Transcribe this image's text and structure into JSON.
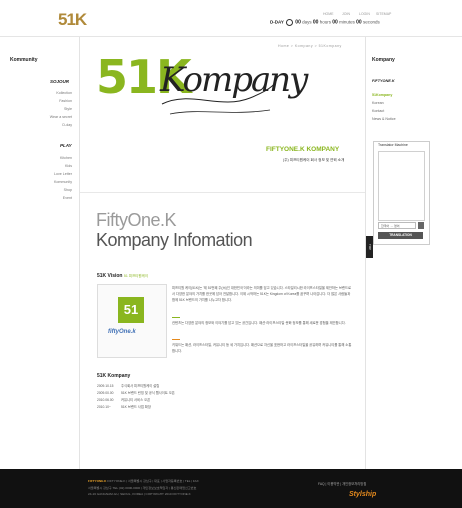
{
  "header": {
    "logo_main": "51",
    "logo_k": "K",
    "util_links": [
      "HOME",
      "JOIN",
      "LOGIN",
      "SITEMAP"
    ],
    "dday": {
      "label": "D-DAY",
      "days_value": "00",
      "days_label": "days",
      "hours_value": "00",
      "hours_label": "hours",
      "minutes_value": "00",
      "minutes_label": "minutes",
      "seconds_value": "00",
      "seconds_label": "seconds"
    }
  },
  "left_nav": {
    "section1_title": "Kommunity",
    "section1_sub": "SOJOUR",
    "section1_items": [
      "Kollection",
      "Fashion",
      "Style",
      "Wear a secret",
      "D-day"
    ],
    "section2_sub": "PLAY",
    "section2_items": [
      "Kitchen",
      "Kids",
      "Love Letter",
      "Kommunity",
      "Shop",
      "Event"
    ]
  },
  "right_nav": {
    "title": "Kompany",
    "sub": "FIFTYONE.K",
    "items": [
      "51Kompany",
      "Korean",
      "Kontact",
      "News & Notice"
    ],
    "active_index": 0
  },
  "translator": {
    "title": "Translator Machine",
    "select_value": "한국어 → 영어",
    "button": "TRANSLATION"
  },
  "top_button": "TOP",
  "main": {
    "breadcrumb": "Home  >  Kompany  >  51Kompany",
    "hero_number": "51K",
    "hero_script": "Kompany",
    "company_name": "FIFTYONE.K KOMPANY",
    "company_sub": "(주) 피프티원케이 회사 정보 및 연혁 소개",
    "info_title_line1": "FiftyOne.K",
    "info_title_line2": "Kompany Infomation",
    "vision_title": "51K Vision",
    "vision_sub": "51 피프티원케이",
    "vision_logo": "51",
    "vision_logo_text": "fiftyOne.k",
    "paragraphs": [
      "피프티원 케이(51K)는 '제 51번째 주(州)인 대한민국'이라는 의미를 담고 있습니다. 스타일리시한 라이프스타일을 제안하는 브랜드로서 다양한 분야의 가치를 한곳에 담아 전달합니다. 이제 시작하는 51K는 Kingdom of Korea를 꿈꾸며 나아갑니다. 더 많은 사람들과 함께 51K 브랜드의 가치를 나누고자 합니다.",
      "컨텐츠는 다양한 분야의 정보와 이야기를 담고 있는 공간입니다. 패션·라이프스타일·문화 정보를 통해 새로운 경험을 제안합니다.",
      "키워드는 패션, 라이프스타일, 커뮤니티 등 세 가지입니다. 패션으로 자신을 표현하고 라이프스타일을 공유하며 커뮤니티를 통해 소통합니다."
    ],
    "company_history_title": "51K Kompany",
    "history": [
      {
        "date": "2009.10.15",
        "text": "주식회사 피프티원케이 설립"
      },
      {
        "date": "2009.00.00",
        "text": "51K 브랜드 런칭 및 공식 웹사이트 오픈"
      },
      {
        "date": "2010.06.00",
        "text": "커뮤니티 서비스 오픈"
      },
      {
        "date": "2010.10~",
        "text": "51K 브랜드 사업 확장"
      }
    ]
  },
  "footer": {
    "brand": "FIFTYONE.K",
    "lines": [
      "FIFTYONE.K | 서울특별시 강남구 | 대표 | 사업자등록번호 | TEL | FAX",
      "서울특별시 강남구 TEL (02) 0000-0000 | 개인정보보호책임자 | 통신판매업신고번호",
      "24-16 GANGNAM-GU, SEOUL, KOREA | COPYRIGHT 2010 FIFTYONE.K"
    ],
    "links": "FAQ | 이용약관 | 개인정보처리방침",
    "partner": "Stylship"
  }
}
